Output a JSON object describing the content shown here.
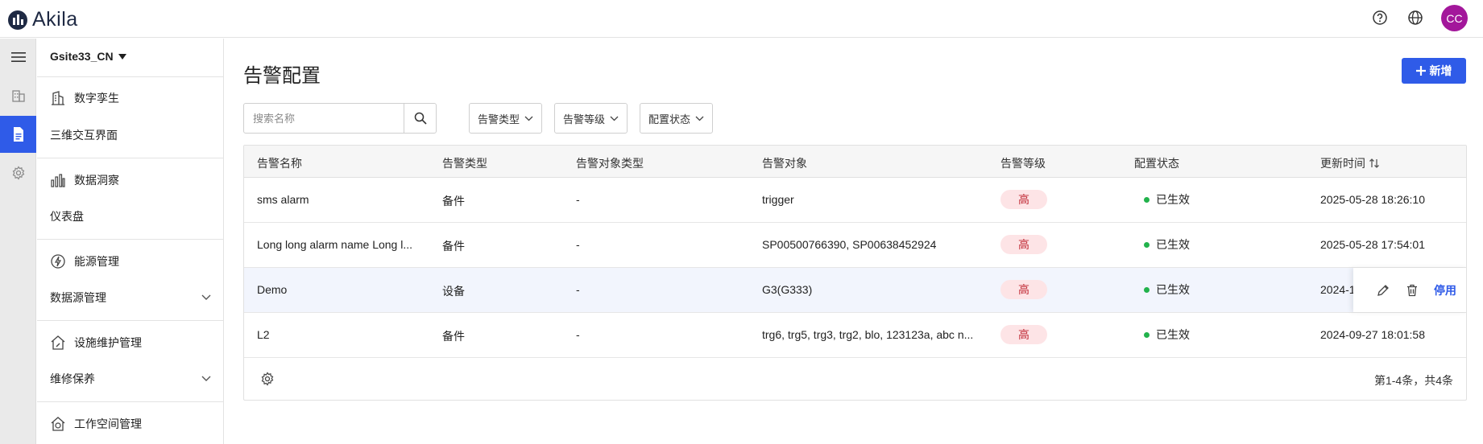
{
  "app": {
    "name": "Akila",
    "avatar_initials": "CC"
  },
  "sidebar": {
    "site": "Gsite33_CN",
    "sections": [
      {
        "title": "数字孪生",
        "icon": "building-icon",
        "items": [
          {
            "label": "三维交互界面",
            "expandable": false
          }
        ]
      },
      {
        "title": "数据洞察",
        "icon": "bar-chart-icon",
        "items": [
          {
            "label": "仪表盘",
            "expandable": false
          }
        ]
      },
      {
        "title": "能源管理",
        "icon": "energy-icon",
        "items": [
          {
            "label": "数据源管理",
            "expandable": true
          }
        ]
      },
      {
        "title": "设施维护管理",
        "icon": "house-wrench-icon",
        "items": [
          {
            "label": "维修保养",
            "expandable": true
          }
        ]
      },
      {
        "title": "工作空间管理",
        "icon": "workspace-icon",
        "items": []
      }
    ]
  },
  "page": {
    "title": "告警配置",
    "add_label": "新增",
    "search_placeholder": "搜索名称",
    "filters": [
      "告警类型",
      "告警等级",
      "配置状态"
    ]
  },
  "table": {
    "columns": [
      "告警名称",
      "告警类型",
      "告警对象类型",
      "告警对象",
      "告警等级",
      "配置状态",
      "更新时间"
    ],
    "rows": [
      {
        "name": "sms alarm",
        "type": "备件",
        "object_type": "-",
        "object": "trigger",
        "level": "高",
        "status": "已生效",
        "updated": "2025-05-28 18:26:10"
      },
      {
        "name": "Long long alarm name Long l...",
        "type": "备件",
        "object_type": "-",
        "object": "SP00500766390, SP00638452924",
        "level": "高",
        "status": "已生效",
        "updated": "2025-05-28 17:54:01"
      },
      {
        "name": "Demo",
        "type": "设备",
        "object_type": "-",
        "object": "G3(G333)",
        "level": "高",
        "status": "已生效",
        "updated": "2024-1"
      },
      {
        "name": "L2",
        "type": "备件",
        "object_type": "-",
        "object": "trg6, trg5, trg3, trg2, blo, 123123a, abc n...",
        "level": "高",
        "status": "已生效",
        "updated": "2024-09-27 18:01:58"
      }
    ],
    "row_action": "停用",
    "pagination": "第1-4条，共4条"
  },
  "colors": {
    "accent": "#2f5be8",
    "level_bg": "#fde4e6",
    "level_text": "#c02a35",
    "status_dot": "#22b24c",
    "avatar": "#a3179b"
  }
}
